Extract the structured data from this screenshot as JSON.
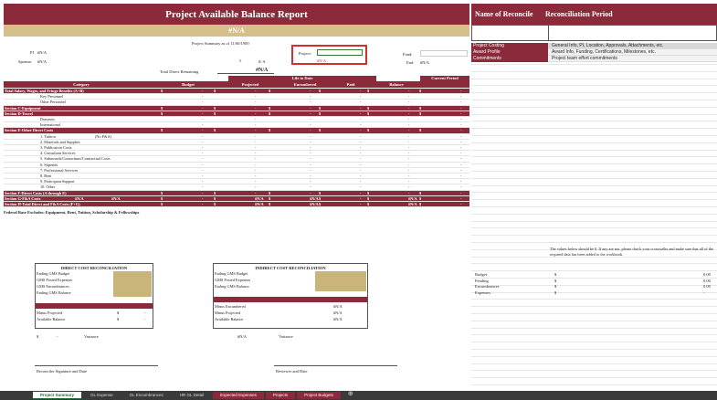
{
  "report": {
    "title": "Project Available Balance Report",
    "na_banner": "#N/A",
    "summary_label": "Project Summary as of 11/00/1900",
    "pi_label": "PI",
    "pi_value": "#N/A",
    "sponsor_label": "Sponsor",
    "sponsor_value": "#N/A",
    "project_label": "Project:",
    "project_value": "",
    "project_sub": "#N/A",
    "fund_label": "Fund:",
    "fund_value": "",
    "end_label": "End:",
    "end_value": "#N/A",
    "mid_value": "0",
    "mid_na": "0/ A",
    "total_direct_label": "Total Direct Remaining",
    "total_direct_value": "#N/A"
  },
  "table": {
    "header_life": "Life to Date",
    "header_current": "Current Period",
    "columns": [
      "Category",
      "Budget",
      "Projected",
      "Encumbered",
      "Paid",
      "Balance"
    ],
    "rows": [
      {
        "label": "Total Salary, Wages, and Fringe Benefits (A+B)",
        "style": "red"
      },
      {
        "label": "Key Personnel",
        "style": "indent"
      },
      {
        "label": "Other Personnel",
        "style": "indent"
      },
      {
        "label": "Section C-Equipment",
        "style": "red"
      },
      {
        "label": "Section D-Travel",
        "style": "red"
      },
      {
        "label": "Domestic",
        "style": "indent"
      },
      {
        "label": "International",
        "style": "indent"
      },
      {
        "label": "Section E-Other Direct Costs",
        "style": "red"
      },
      {
        "label": "1. Tuition",
        "style": "indent",
        "note": "(No F&A)"
      },
      {
        "label": "2. Materials and Supplies",
        "style": "indent"
      },
      {
        "label": "3. Publication Costs",
        "style": "indent"
      },
      {
        "label": "4. Consultant Services",
        "style": "indent"
      },
      {
        "label": "5. Subawards/Consortium/Contractual Costs",
        "style": "indent"
      },
      {
        "label": "6. Stipends",
        "style": "indent"
      },
      {
        "label": "7. Professional Services",
        "style": "indent"
      },
      {
        "label": "8. Rent",
        "style": "indent"
      },
      {
        "label": "9. Participant Support",
        "style": "indent"
      },
      {
        "label": "10. Other",
        "style": "indent"
      },
      {
        "label": "Section F-Direct Costs (A through E)",
        "style": "red"
      },
      {
        "label": "Section G-F&A Costs",
        "style": "red",
        "na1": "#N/A",
        "na2": "#N/A"
      },
      {
        "label": "Section H-Total Direct and F&A Costs (F+G)",
        "style": "red"
      }
    ],
    "cell_dash": "-",
    "cell_dollar": "$",
    "cell_na": "#N/A",
    "footnote": "Federal Base Excludes: Equipment, Rent, Tuition, Scholarship & Fellowships"
  },
  "direct_recon": {
    "title": "DIRECT COST RECONCILIATION",
    "lines": [
      "Ending GMS Budget",
      "GMS Posted Expenses",
      "GMS Encumbrances",
      "Ending GMS Balance"
    ],
    "minus_projected": "Minus Projected",
    "available_balance": "Available Balance",
    "dollar": "$",
    "dash": "-",
    "variance_label": "Variance"
  },
  "indirect_recon": {
    "title": "INDIRECT COST RECONCILIATION",
    "lines": [
      "Ending GMS Budget",
      "GMS Posted Expenses",
      "Ending GMS Balance"
    ],
    "minus_encumbered": "Minus Encumbered",
    "minus_projected": "Minus Projected",
    "available_balance": "Available Balance",
    "na": "#N/A",
    "variance_value": "#N/A",
    "variance_label": "Variance"
  },
  "signatures": {
    "reconciler": "Reconciler Signature and Date",
    "reviewer": "Reviewer and Date"
  },
  "right_panel": {
    "col1_header": "Name of Reconcile",
    "col2_header": "Reconciliation Period",
    "items": [
      {
        "name": "Project Costing",
        "desc": "General Info, PI, Location, Approvals, Attachments, etc."
      },
      {
        "name": "Award Profile",
        "desc": "Award Info, Funding, Certifications, Milestones, etc."
      },
      {
        "name": "Commitments",
        "desc": "Project team effort commitments"
      }
    ],
    "check_note": "The values below should be 0. If any are not, please check your crosswalks and make sure that all of the required data has been added to the workbook.",
    "checks": [
      {
        "label": "Budget",
        "dollar": "$",
        "value": "0.00"
      },
      {
        "label": "Pending",
        "dollar": "$",
        "value": "0.00"
      },
      {
        "label": "Encumbrances",
        "dollar": "$",
        "value": "0.00"
      },
      {
        "label": "Expenses",
        "dollar": "$",
        "value": "-"
      }
    ]
  },
  "sheet_tabs": [
    "Project Summary",
    "GL Expense",
    "GL Encumbrances",
    "HR GL Detail",
    "Expected Expenses",
    "Projects",
    "Project Budgets"
  ],
  "colors": {
    "accent": "#8b2a3a",
    "tan": "#d6c08a",
    "highlight": "#d32f2f",
    "active_tab": "#1e6b35"
  }
}
